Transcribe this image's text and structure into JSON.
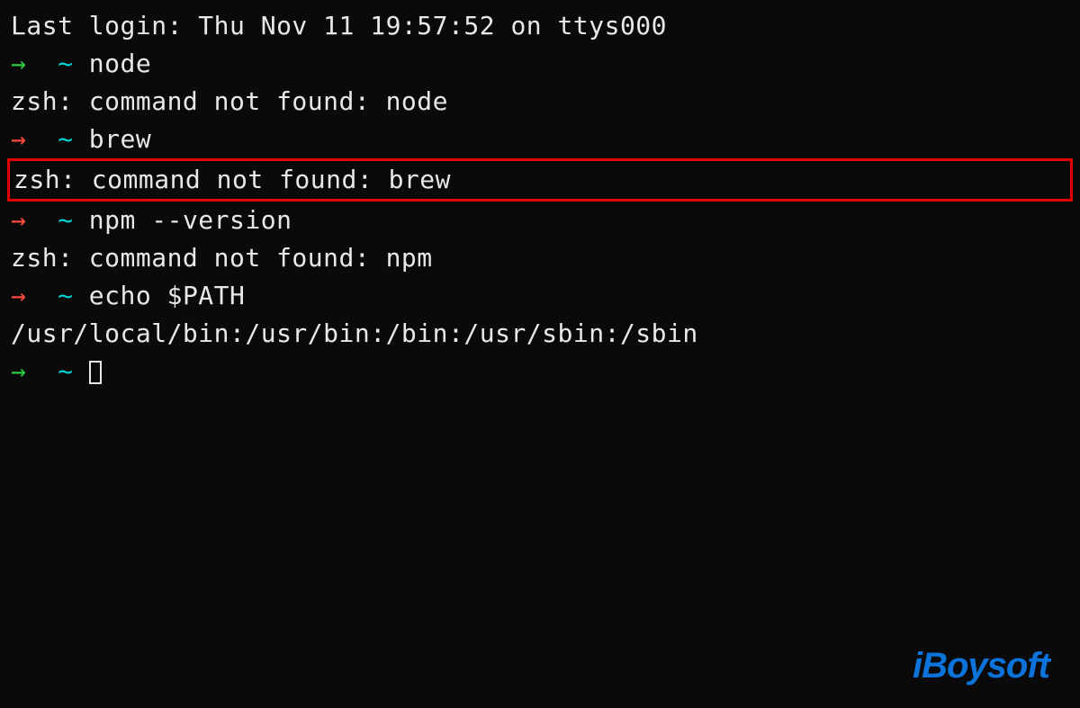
{
  "terminal": {
    "last_login": "Last login: Thu Nov 11 19:57:52 on ttys000",
    "prompt_arrow": "→",
    "prompt_tilde": "~",
    "lines": [
      {
        "type": "prompt",
        "arrow_color": "green",
        "command": "node"
      },
      {
        "type": "output",
        "text": "zsh: command not found: node"
      },
      {
        "type": "prompt",
        "arrow_color": "red",
        "command": "brew"
      },
      {
        "type": "output",
        "text": "zsh: command not found: brew",
        "highlighted": true
      },
      {
        "type": "prompt",
        "arrow_color": "red",
        "command": "npm --version"
      },
      {
        "type": "output",
        "text": "zsh: command not found: npm"
      },
      {
        "type": "prompt",
        "arrow_color": "red",
        "command": "echo $PATH"
      },
      {
        "type": "output",
        "text": "/usr/local/bin:/usr/bin:/bin:/usr/sbin:/sbin"
      },
      {
        "type": "prompt",
        "arrow_color": "green",
        "command": "",
        "cursor": true
      }
    ]
  },
  "watermark": "iBoysoft"
}
